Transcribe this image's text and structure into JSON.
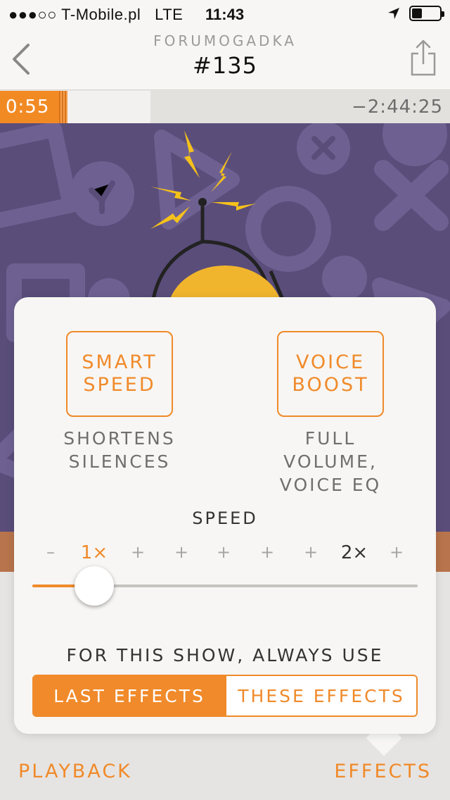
{
  "status_bar": {
    "carrier": "●●●○○ T-Mobile.pl",
    "network": "LTE",
    "time": "11:43"
  },
  "nav": {
    "podcast_name": "FORUMOGADKA",
    "episode_title": "#135"
  },
  "progress": {
    "elapsed": "0:55",
    "remaining": "−2:44:25"
  },
  "effects": {
    "smart_speed": {
      "line1": "SMART",
      "line2": "SPEED"
    },
    "smart_speed_desc": {
      "line1": "SHORTENS",
      "line2": "SILENCES"
    },
    "voice_boost": {
      "line1": "VOICE",
      "line2": "BOOST"
    },
    "voice_boost_desc": {
      "line1": "FULL",
      "line2": "VOLUME,",
      "line3": "VOICE EQ"
    },
    "speed_label": "SPEED",
    "speed_marks": [
      "–",
      "1×",
      "+",
      "+",
      "+",
      "+",
      "+",
      "2×",
      "+"
    ],
    "speed_selected_index": 1,
    "always_label": "FOR THIS SHOW, ALWAYS USE",
    "segments": [
      "LAST EFFECTS",
      "THESE EFFECTS"
    ],
    "selected_segment": 0
  },
  "tabs": {
    "playback": "PLAYBACK",
    "effects": "EFFECTS"
  },
  "colors": {
    "accent": "#f08a2a",
    "artwork_bg": "#5a4d7a",
    "popover_bg": "#f7f6f4"
  }
}
